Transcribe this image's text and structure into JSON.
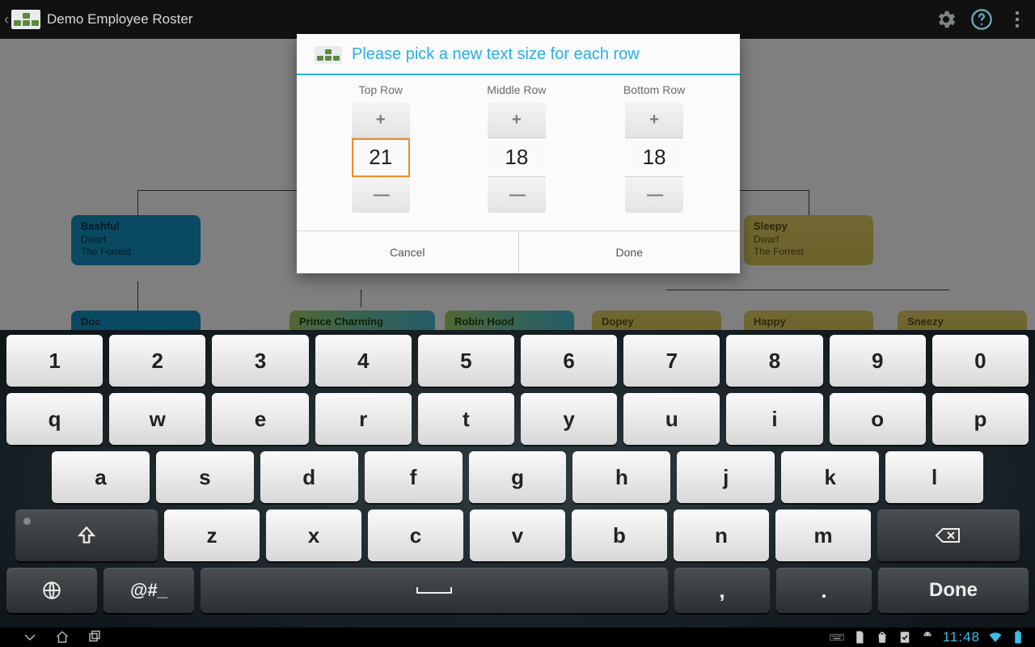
{
  "actionbar": {
    "title": "Demo Employee Roster"
  },
  "nodes": {
    "bashful": {
      "name": "Bashful",
      "role": "Dwarf",
      "loc": "The Forrest"
    },
    "sleepy": {
      "name": "Sleepy",
      "role": "Dwarf",
      "loc": "The Forrest"
    },
    "doc": {
      "name": "Doc"
    },
    "prince": {
      "name": "Prince Charming"
    },
    "robin": {
      "name": "Robin Hood"
    },
    "dopey": {
      "name": "Dopey"
    },
    "happy": {
      "name": "Happy"
    },
    "sneezy": {
      "name": "Sneezy"
    }
  },
  "dialog": {
    "title": "Please pick a new text size for each row",
    "pickers": {
      "top": {
        "label": "Top Row",
        "value": "21"
      },
      "middle": {
        "label": "Middle Row",
        "value": "18"
      },
      "bottom": {
        "label": "Bottom Row",
        "value": "18"
      }
    },
    "cancel": "Cancel",
    "done": "Done"
  },
  "keyboard": {
    "row_num": [
      "1",
      "2",
      "3",
      "4",
      "5",
      "6",
      "7",
      "8",
      "9",
      "0"
    ],
    "row_q": [
      "q",
      "w",
      "e",
      "r",
      "t",
      "y",
      "u",
      "i",
      "o",
      "p"
    ],
    "row_a": [
      "a",
      "s",
      "d",
      "f",
      "g",
      "h",
      "j",
      "k",
      "l"
    ],
    "row_z": [
      "z",
      "x",
      "c",
      "v",
      "b",
      "n",
      "m"
    ],
    "sym_key": "@#_",
    "comma": ",",
    "period": ".",
    "done": "Done"
  },
  "statusbar": {
    "time": "11:48"
  }
}
